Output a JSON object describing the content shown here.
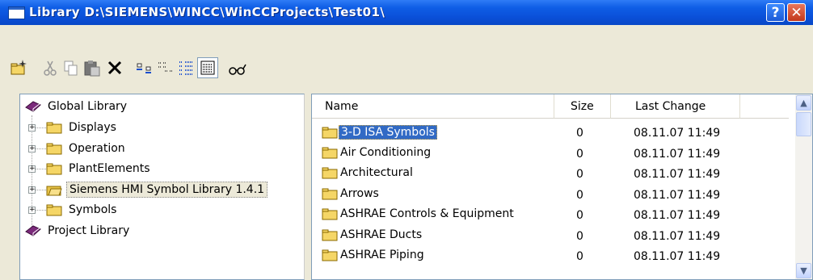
{
  "window": {
    "title": "Library  D:\\SIEMENS\\WINCC\\WinCCProjects\\Test01\\",
    "help_label": "?",
    "close_label": "✕"
  },
  "toolbar": {
    "buttons": [
      {
        "name": "new-folder",
        "icon": "new-folder-icon"
      },
      {
        "name": "cut",
        "icon": "cut-icon"
      },
      {
        "name": "copy",
        "icon": "copy-icon"
      },
      {
        "name": "paste",
        "icon": "paste-icon"
      },
      {
        "name": "delete",
        "icon": "delete-icon"
      },
      {
        "name": "small-icons",
        "icon": "small-icons-icon"
      },
      {
        "name": "large-icons",
        "icon": "large-icons-icon"
      },
      {
        "name": "list-view",
        "icon": "list-view-icon"
      },
      {
        "name": "details-view",
        "icon": "details-view-icon",
        "pressed": true
      },
      {
        "name": "preview",
        "icon": "glasses-icon"
      }
    ]
  },
  "tree": {
    "global_library": "Global Library",
    "items": [
      "Displays",
      "Operation",
      "PlantElements",
      "Siemens HMI Symbol Library 1.4.1",
      "Symbols"
    ],
    "selected_index": 3,
    "project_library": "Project Library"
  },
  "list": {
    "columns": [
      "Name",
      "Size",
      "Last Change"
    ],
    "rows": [
      {
        "name": "3-D ISA Symbols",
        "size": "0",
        "date": "08.11.07 11:49",
        "selected": true
      },
      {
        "name": "Air Conditioning",
        "size": "0",
        "date": "08.11.07 11:49"
      },
      {
        "name": "Architectural",
        "size": "0",
        "date": "08.11.07 11:49"
      },
      {
        "name": "Arrows",
        "size": "0",
        "date": "08.11.07 11:49"
      },
      {
        "name": "ASHRAE Controls & Equipment",
        "size": "0",
        "date": "08.11.07 11:49"
      },
      {
        "name": "ASHRAE Ducts",
        "size": "0",
        "date": "08.11.07 11:49"
      },
      {
        "name": "ASHRAE Piping",
        "size": "0",
        "date": "08.11.07 11:49"
      }
    ]
  },
  "colors": {
    "titlebar": "#0a4fd8",
    "selection": "#316ac5",
    "folder": "#f5d666",
    "book": "#7b2a7b"
  }
}
